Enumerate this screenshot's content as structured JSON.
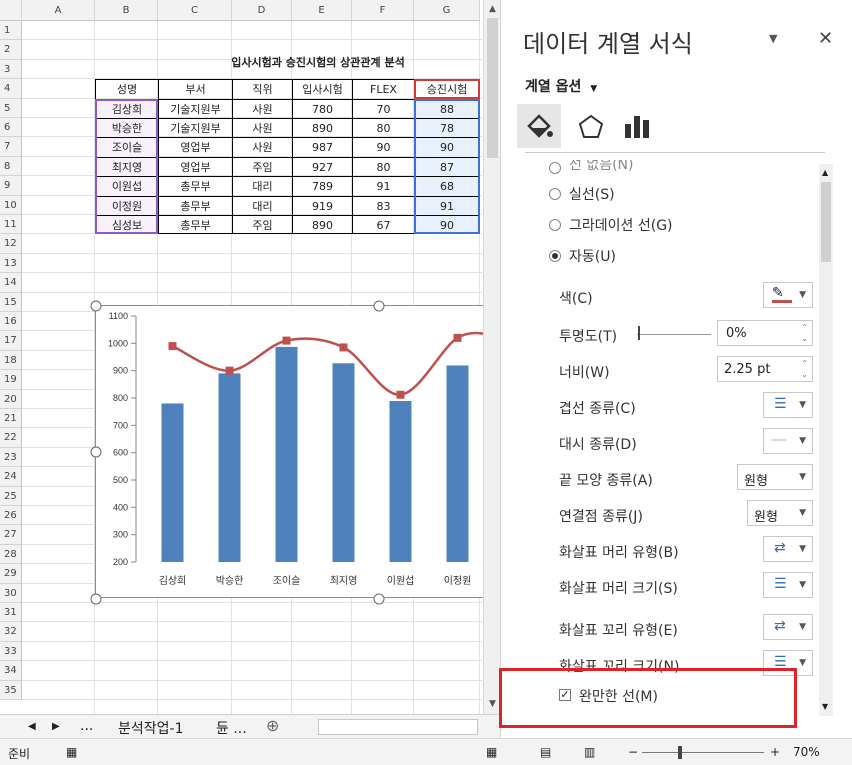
{
  "sheet": {
    "columns": [
      "A",
      "B",
      "C",
      "D",
      "E",
      "F",
      "G"
    ],
    "rows": [
      "1",
      "2",
      "3",
      "4",
      "5",
      "6",
      "7",
      "8",
      "9",
      "10",
      "11",
      "12",
      "13",
      "14",
      "15",
      "16",
      "17",
      "18",
      "19",
      "20",
      "21",
      "22",
      "23",
      "24",
      "25",
      "26",
      "27",
      "28",
      "29",
      "30",
      "31",
      "32",
      "33",
      "34",
      "35"
    ],
    "title": "입사시험과 승진시험의 상관관계 분석",
    "headers": [
      "성명",
      "부서",
      "직위",
      "입사시험",
      "FLEX",
      "승진시험"
    ],
    "table": [
      [
        "김상희",
        "기술지원부",
        "사원",
        "780",
        "70",
        "88"
      ],
      [
        "박승한",
        "기술지원부",
        "사원",
        "890",
        "80",
        "78"
      ],
      [
        "조이슬",
        "영업부",
        "사원",
        "987",
        "90",
        "90"
      ],
      [
        "최지영",
        "영업부",
        "주임",
        "927",
        "80",
        "87"
      ],
      [
        "이원섭",
        "총무부",
        "대리",
        "789",
        "91",
        "68"
      ],
      [
        "이정원",
        "총무부",
        "대리",
        "919",
        "83",
        "91"
      ],
      [
        "심성보",
        "총무부",
        "주임",
        "890",
        "67",
        "90"
      ]
    ]
  },
  "chart_data": {
    "type": "bar",
    "categories": [
      "김상희",
      "박승한",
      "조이슬",
      "최지영",
      "이원섭",
      "이정원"
    ],
    "yticks": [
      "1100",
      "1000",
      "900",
      "800",
      "700",
      "600",
      "500",
      "400",
      "300",
      "200"
    ],
    "ylim": [
      200,
      1100
    ],
    "series": [
      {
        "kind": "bar",
        "color": "#4f81bd",
        "values": [
          780,
          890,
          987,
          927,
          789,
          919
        ]
      },
      {
        "kind": "line",
        "smooth": true,
        "color": "#c0504d",
        "values": [
          990,
          900,
          1010,
          985,
          812,
          1020
        ]
      }
    ]
  },
  "tabs": {
    "prev": "◀",
    "next": "▶",
    "more": "...",
    "sheet1": "분석작업-1",
    "sheet2": "듄 ...",
    "add": "⊕"
  },
  "status": {
    "ready": "준비",
    "zoom": "70%",
    "minus": "−",
    "plus": "+"
  },
  "pane": {
    "title": "데이터 계열 서식",
    "options": "계열 옵션",
    "opt_partial": "선 없음(N)",
    "solid": "실선(S)",
    "gradient": "그라데이션 선(G)",
    "auto": "자동(U)",
    "color": "색(C)",
    "transparency": "투명도(T)",
    "transparency_val": "0%",
    "width": "너비(W)",
    "width_val": "2.25 pt",
    "compound": "겹선 종류(C)",
    "dash": "대시 종류(D)",
    "cap": "끝 모양 종류(A)",
    "cap_val": "원형",
    "join": "연결점 종류(J)",
    "join_val": "원형",
    "begin_arrow": "화살표 머리 유형(B)",
    "begin_size": "화살표 머리 크기(S)",
    "end_arrow": "화살표 꼬리 유형(E)",
    "end_size": "화살표 꼬리 크기(N)",
    "smooth": "완만한 선(M)"
  }
}
